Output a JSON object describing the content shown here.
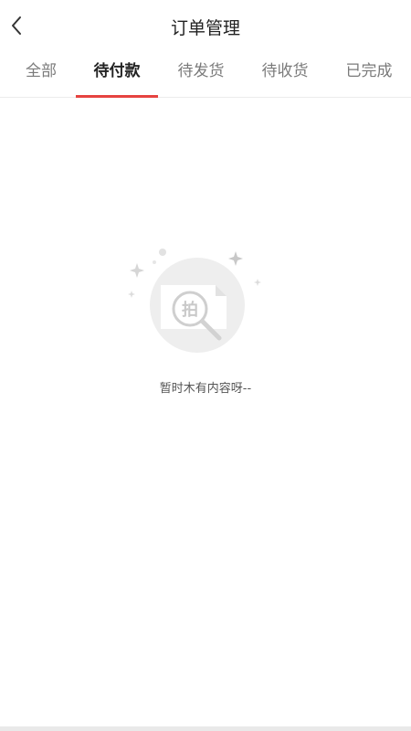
{
  "header": {
    "title": "订单管理"
  },
  "tabs": [
    {
      "label": "全部",
      "active": false
    },
    {
      "label": "待付款",
      "active": true
    },
    {
      "label": "待发货",
      "active": false
    },
    {
      "label": "待收货",
      "active": false
    },
    {
      "label": "已完成",
      "active": false
    }
  ],
  "empty_state": {
    "message": "暂时木有内容呀--",
    "illustration_glyph": "拍"
  },
  "colors": {
    "accent": "#e64340",
    "tab_active_text": "#222222",
    "tab_inactive_text": "#7a7a7a"
  },
  "icons": {
    "back": "chevron-left-icon",
    "empty": "empty-box-search-icon"
  }
}
